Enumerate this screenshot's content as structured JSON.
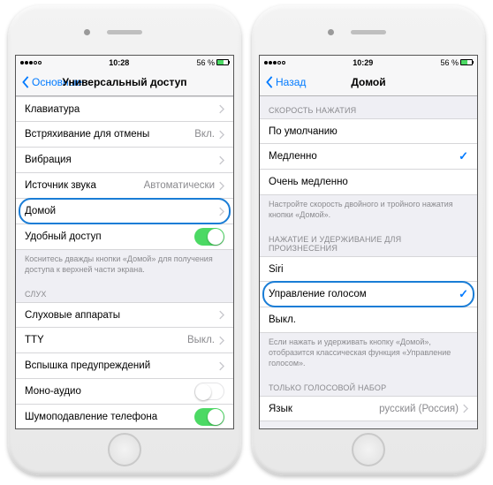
{
  "status": {
    "time_l": "10:28",
    "time_r": "10:29",
    "batt": "56 %",
    "bt": "⚡︎"
  },
  "left": {
    "back": "Основные",
    "title": "Универсальный доступ",
    "g1": [
      {
        "label": "Клавиатура",
        "type": "chev"
      },
      {
        "label": "Встряхивание для отмены",
        "type": "val",
        "val": "Вкл."
      },
      {
        "label": "Вибрация",
        "type": "chev"
      },
      {
        "label": "Источник звука",
        "type": "val",
        "val": "Автоматически"
      },
      {
        "label": "Домой",
        "type": "chev",
        "hl": true
      },
      {
        "label": "Удобный доступ",
        "type": "switch",
        "on": true
      }
    ],
    "foot1": "Коснитесь дважды кнопки «Домой» для получения доступа к верхней части экрана.",
    "h2": "СЛУХ",
    "g2": [
      {
        "label": "Слуховые аппараты",
        "type": "chev"
      },
      {
        "label": "TTY",
        "type": "val",
        "val": "Выкл."
      },
      {
        "label": "Вспышка предупреждений",
        "type": "chev"
      },
      {
        "label": "Моно-аудио",
        "type": "switch",
        "on": false
      },
      {
        "label": "Шумоподавление телефона",
        "type": "switch",
        "on": true
      }
    ]
  },
  "right": {
    "back": "Назад",
    "title": "Домой",
    "h1": "СКОРОСТЬ НАЖАТИЯ",
    "g1": [
      {
        "label": "По умолчанию",
        "type": "plain"
      },
      {
        "label": "Медленно",
        "type": "check"
      },
      {
        "label": "Очень медленно",
        "type": "plain"
      }
    ],
    "foot1": "Настройте скорость двойного и тройного нажатия кнопки «Домой».",
    "h2": "НАЖАТИЕ И УДЕРЖИВАНИЕ ДЛЯ ПРОИЗНЕСЕНИЯ",
    "g2": [
      {
        "label": "Siri",
        "type": "plain"
      },
      {
        "label": "Управление голосом",
        "type": "check",
        "hl": true
      },
      {
        "label": "Выкл.",
        "type": "plain"
      }
    ],
    "foot2": "Если нажать и удерживать кнопку «Домой», отобразится классическая функция «Управление голосом».",
    "h3": "ТОЛЬКО ГОЛОСОВОЙ НАБОР",
    "g3": [
      {
        "label": "Язык",
        "type": "val",
        "val": "русский (Россия)"
      }
    ]
  }
}
